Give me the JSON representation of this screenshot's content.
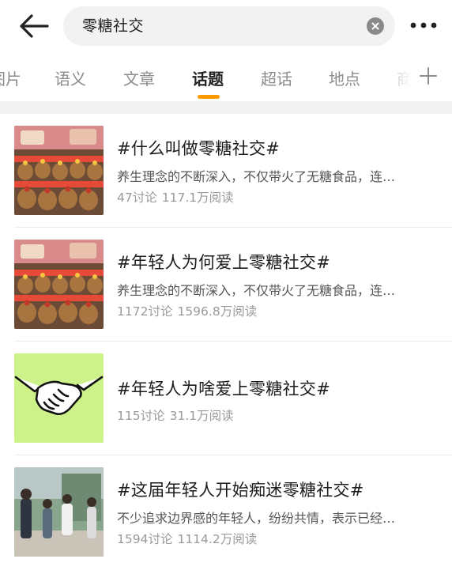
{
  "search": {
    "query": "零糖社交"
  },
  "tabs": [
    "图片",
    "语义",
    "文章",
    "话题",
    "超话",
    "地点",
    "商品"
  ],
  "active_tab": "话题",
  "topics": [
    {
      "title": "#什么叫做零糖社交#",
      "desc": "养生理念的不断深入，不仅带火了无糖食品，连…",
      "discussions": "47讨论",
      "reads": "117.1万阅读",
      "thumb": "plush-toys-photo"
    },
    {
      "title": "#年轻人为何爱上零糖社交#",
      "desc": "养生理念的不断深入，不仅带火了无糖食品，连…",
      "discussions": "1172讨论",
      "reads": "1596.8万阅读",
      "thumb": "plush-toys-photo"
    },
    {
      "title": "#年轻人为啥爱上零糖社交#",
      "desc": "",
      "discussions": "115讨论",
      "reads": "31.1万阅读",
      "thumb": "handshake-illustration"
    },
    {
      "title": "#这届年轻人开始痴迷零糖社交#",
      "desc": "不少追求边界感的年轻人，纷纷共情，表示已经…",
      "discussions": "1594讨论",
      "reads": "1114.2万阅读",
      "thumb": "people-outdoor-photo"
    }
  ],
  "colors": {
    "accent": "#ff9a00",
    "handshake_bg": "#cdf28a"
  }
}
